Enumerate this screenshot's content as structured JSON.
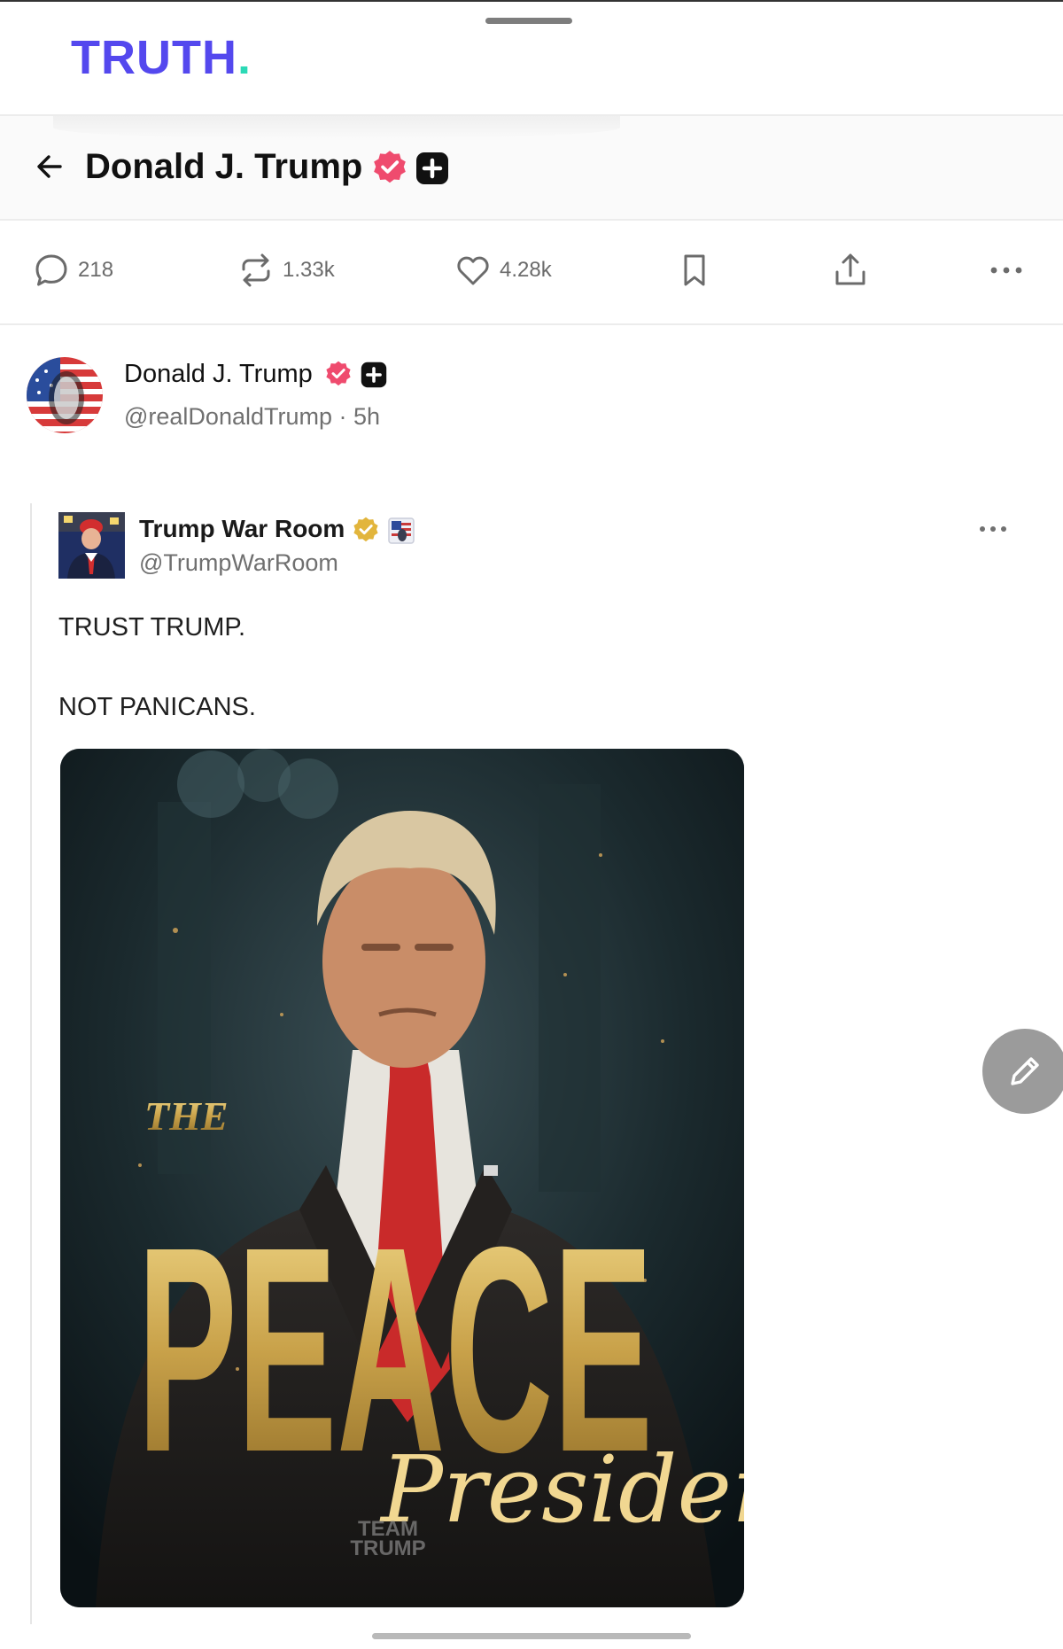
{
  "app": {
    "logo_text": "TRUTH",
    "logo_dot": ".",
    "brand_color": "#5448ee",
    "accent_color": "#2bd9b6"
  },
  "header": {
    "title": "Donald J. Trump",
    "back_icon": "arrow-left-icon",
    "badges": [
      "verified-badge-icon",
      "plus-badge-icon"
    ]
  },
  "actions": {
    "replies": "218",
    "reposts": "1.33k",
    "likes": "4.28k",
    "icons": [
      "comment-icon",
      "repost-icon",
      "heart-icon",
      "bookmark-icon",
      "share-icon",
      "more-icon"
    ]
  },
  "post": {
    "author_name": "Donald J. Trump",
    "handle": "@realDonaldTrump",
    "separator": "·",
    "time": "5h",
    "verified_color": "#ef4b6e"
  },
  "quoted_post": {
    "author_name": "Trump War Room",
    "handle": "@TrumpWarRoom",
    "verified_color": "#e2b53c",
    "lines": [
      "TRUST TRUMP.",
      "NOT PANICANS."
    ]
  },
  "media": {
    "overlay_the": "THE",
    "overlay_peace": "PEACE",
    "overlay_president": "President",
    "watermark_line1": "TEAM",
    "watermark_line2": "TRUMP"
  },
  "fab": {
    "icon": "pencil-icon"
  }
}
